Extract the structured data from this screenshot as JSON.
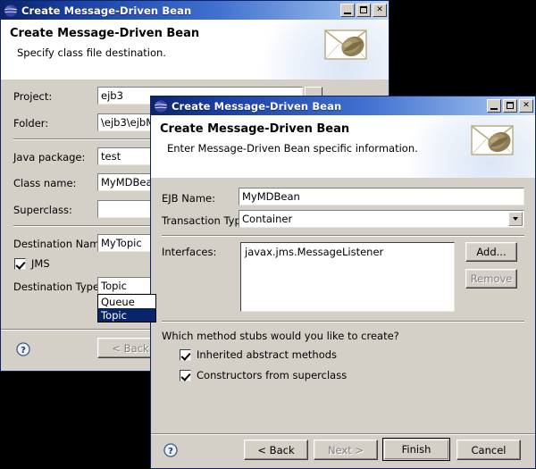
{
  "desktop": {
    "background": "#000000"
  },
  "dialog_back": {
    "title": "Create Message-Driven Bean",
    "titlebar_icon": "eclipse-globe-icon",
    "window_buttons": {
      "minimize": "minimize-icon",
      "maximize": "maximize-icon",
      "close": "close-icon"
    },
    "banner": {
      "title": "Create Message-Driven Bean",
      "subtitle": "Specify class file destination.",
      "icon": "envelope-bean-icon"
    },
    "fields": {
      "project_label": "Project:",
      "project_value": "ejb3",
      "folder_label": "Folder:",
      "folder_value": "\\ejb3\\ejbM",
      "java_package_label": "Java package:",
      "java_package_value": "test",
      "class_name_label": "Class name:",
      "class_name_value": "MyMDBean",
      "superclass_label": "Superclass:",
      "superclass_value": "",
      "destination_name_label": "Destination Name:",
      "destination_name_value": "MyTopic",
      "jms_label": "JMS",
      "jms_checked": true,
      "destination_type_label": "Destination Type:",
      "destination_type_value": "Topic",
      "destination_type_options": [
        "Queue",
        "Topic"
      ],
      "destination_type_selected": "Topic"
    },
    "buttons": {
      "help": "help-icon",
      "back": "< Back"
    }
  },
  "dialog_front": {
    "title": "Create Message-Driven Bean",
    "titlebar_icon": "eclipse-globe-icon",
    "window_buttons": {
      "minimize": "minimize-icon",
      "maximize": "maximize-icon",
      "close": "close-icon"
    },
    "banner": {
      "title": "Create Message-Driven Bean",
      "subtitle": "Enter Message-Driven Bean specific information.",
      "icon": "envelope-bean-icon"
    },
    "fields": {
      "ejb_name_label": "EJB Name:",
      "ejb_name_value": "MyMDBean",
      "transaction_type_label": "Transaction Type",
      "transaction_type_value": "Container",
      "interfaces_label": "Interfaces:",
      "interfaces_items": [
        "javax.jms.MessageListener"
      ],
      "add_button": "Add...",
      "remove_button": "Remove",
      "method_stubs_question": "Which method stubs would you like to create?",
      "inherited_abstract_label": "Inherited abstract methods",
      "inherited_abstract_checked": true,
      "constructors_label": "Constructors from superclass",
      "constructors_checked": true
    },
    "buttons": {
      "help": "help-icon",
      "back": "< Back",
      "next": "Next >",
      "finish": "Finish",
      "cancel": "Cancel"
    }
  }
}
